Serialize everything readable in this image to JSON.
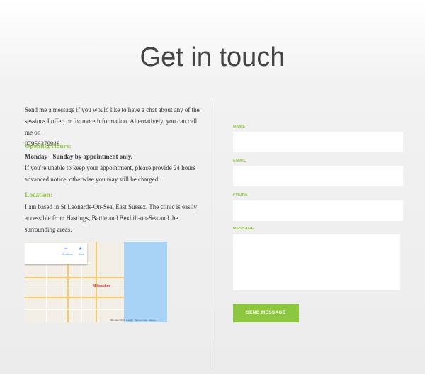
{
  "page": {
    "title": "Get in touch"
  },
  "intro": {
    "text": "Send me a message if you would like to have a chat about any of the sessions I offer, or for more information. Alternatively, you can call me on",
    "phone": "07956379948."
  },
  "hours": {
    "heading": "Opening Hours:",
    "days": "Monday - Sunday by appointment only.",
    "note": "If you're unable to keep your appointment, please provide 24 hours advanced notice, otherwise you may still be charged."
  },
  "location": {
    "heading": "Location:",
    "text": "I am based in St Leonards-On-Sea, East Sussex. The clinic is easily accessible from Hastings, Battle and Bexhill-on-Sea and the surrounding areas."
  },
  "map": {
    "city_label": "Milwaukee",
    "directions_label": "Directions",
    "save_label": "Save",
    "footer": "Map data ©2018 Google · Terms of Use · Report"
  },
  "form": {
    "name_label": "NAME",
    "email_label": "EMAIL",
    "phone_label": "PHONE",
    "message_label": "MESSAGE",
    "submit_label": "SEND MESSAGE"
  },
  "colors": {
    "accent": "#8dc63f",
    "title": "#444444"
  }
}
